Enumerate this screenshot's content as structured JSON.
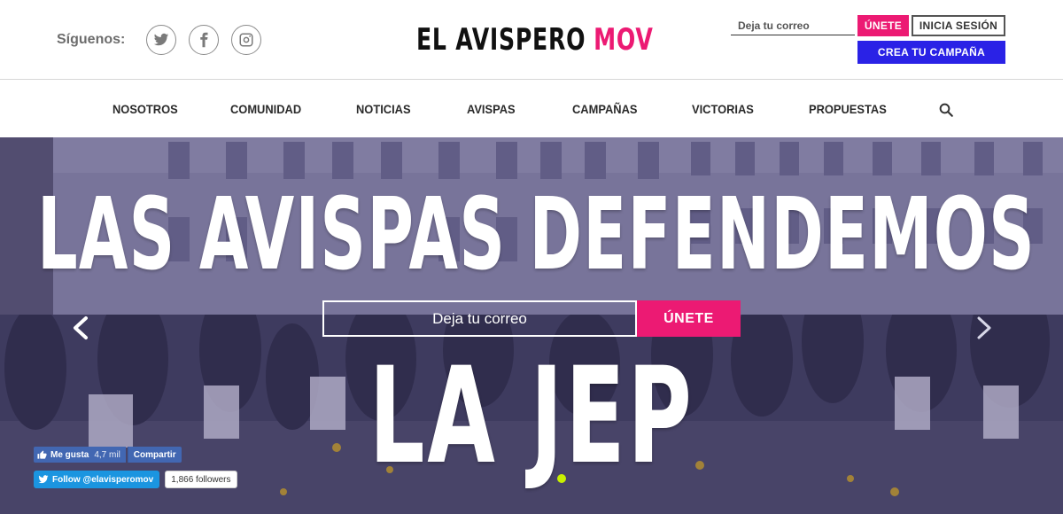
{
  "header": {
    "follow_label": "Síguenos:",
    "social": [
      {
        "name": "twitter-icon"
      },
      {
        "name": "facebook-icon"
      },
      {
        "name": "instagram-icon"
      }
    ],
    "logo": {
      "part1": "EL AVISPERO",
      "part2": "MOV",
      "part2_color": "#ec1a73"
    },
    "newsletter_placeholder": "Deja tu correo",
    "join_label": "ÚNETE",
    "login_label": "INICIA SESIÓN",
    "create_campaign_label": "CREA TU CAMPAÑA"
  },
  "nav": {
    "items": [
      "NOSOTROS",
      "COMUNIDAD",
      "NOTICIAS",
      "AVISPAS",
      "CAMPAÑAS",
      "VICTORIAS",
      "PROPUESTAS"
    ],
    "search_icon": "search-icon"
  },
  "hero": {
    "headline": "LAS AVISPAS DEFENDEMOS",
    "headline2": "LA JEP",
    "input_placeholder": "Deja tu correo",
    "join_label": "ÚNETE",
    "prev_icon": "chevron-left-icon",
    "next_icon": "chevron-right-icon"
  },
  "widgets": {
    "fb_like_label": "Me gusta",
    "fb_like_count": "4,7 mil",
    "fb_share_label": "Compartir",
    "twitter_follow_label": "Follow @elavisperomov",
    "twitter_followers": "1,866 followers"
  },
  "colors": {
    "accent_pink": "#ec1a73",
    "accent_blue": "#2a22e6",
    "facebook_blue": "#4267b2",
    "twitter_blue": "#1b95e0"
  }
}
